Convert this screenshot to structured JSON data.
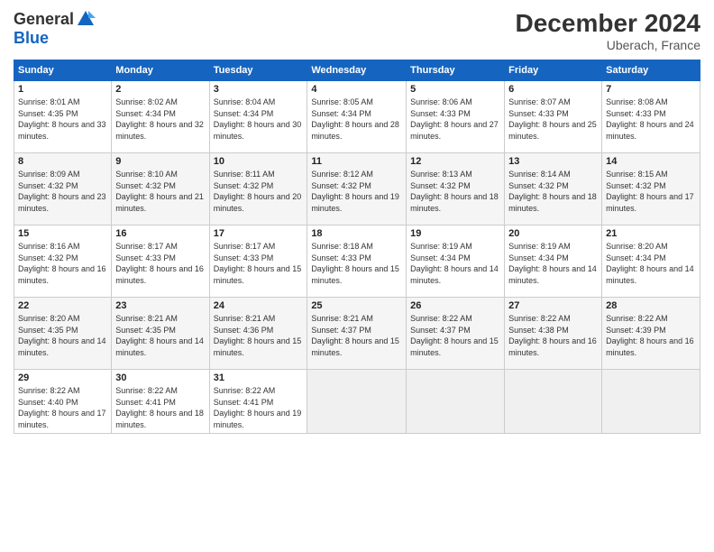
{
  "header": {
    "logo_general": "General",
    "logo_blue": "Blue",
    "month_title": "December 2024",
    "location": "Uberach, France"
  },
  "days_of_week": [
    "Sunday",
    "Monday",
    "Tuesday",
    "Wednesday",
    "Thursday",
    "Friday",
    "Saturday"
  ],
  "weeks": [
    [
      {
        "day": "1",
        "sunrise": "8:01 AM",
        "sunset": "4:35 PM",
        "daylight": "8 hours and 33 minutes."
      },
      {
        "day": "2",
        "sunrise": "8:02 AM",
        "sunset": "4:34 PM",
        "daylight": "8 hours and 32 minutes."
      },
      {
        "day": "3",
        "sunrise": "8:04 AM",
        "sunset": "4:34 PM",
        "daylight": "8 hours and 30 minutes."
      },
      {
        "day": "4",
        "sunrise": "8:05 AM",
        "sunset": "4:34 PM",
        "daylight": "8 hours and 28 minutes."
      },
      {
        "day": "5",
        "sunrise": "8:06 AM",
        "sunset": "4:33 PM",
        "daylight": "8 hours and 27 minutes."
      },
      {
        "day": "6",
        "sunrise": "8:07 AM",
        "sunset": "4:33 PM",
        "daylight": "8 hours and 25 minutes."
      },
      {
        "day": "7",
        "sunrise": "8:08 AM",
        "sunset": "4:33 PM",
        "daylight": "8 hours and 24 minutes."
      }
    ],
    [
      {
        "day": "8",
        "sunrise": "8:09 AM",
        "sunset": "4:32 PM",
        "daylight": "8 hours and 23 minutes."
      },
      {
        "day": "9",
        "sunrise": "8:10 AM",
        "sunset": "4:32 PM",
        "daylight": "8 hours and 21 minutes."
      },
      {
        "day": "10",
        "sunrise": "8:11 AM",
        "sunset": "4:32 PM",
        "daylight": "8 hours and 20 minutes."
      },
      {
        "day": "11",
        "sunrise": "8:12 AM",
        "sunset": "4:32 PM",
        "daylight": "8 hours and 19 minutes."
      },
      {
        "day": "12",
        "sunrise": "8:13 AM",
        "sunset": "4:32 PM",
        "daylight": "8 hours and 18 minutes."
      },
      {
        "day": "13",
        "sunrise": "8:14 AM",
        "sunset": "4:32 PM",
        "daylight": "8 hours and 18 minutes."
      },
      {
        "day": "14",
        "sunrise": "8:15 AM",
        "sunset": "4:32 PM",
        "daylight": "8 hours and 17 minutes."
      }
    ],
    [
      {
        "day": "15",
        "sunrise": "8:16 AM",
        "sunset": "4:32 PM",
        "daylight": "8 hours and 16 minutes."
      },
      {
        "day": "16",
        "sunrise": "8:17 AM",
        "sunset": "4:33 PM",
        "daylight": "8 hours and 16 minutes."
      },
      {
        "day": "17",
        "sunrise": "8:17 AM",
        "sunset": "4:33 PM",
        "daylight": "8 hours and 15 minutes."
      },
      {
        "day": "18",
        "sunrise": "8:18 AM",
        "sunset": "4:33 PM",
        "daylight": "8 hours and 15 minutes."
      },
      {
        "day": "19",
        "sunrise": "8:19 AM",
        "sunset": "4:34 PM",
        "daylight": "8 hours and 14 minutes."
      },
      {
        "day": "20",
        "sunrise": "8:19 AM",
        "sunset": "4:34 PM",
        "daylight": "8 hours and 14 minutes."
      },
      {
        "day": "21",
        "sunrise": "8:20 AM",
        "sunset": "4:34 PM",
        "daylight": "8 hours and 14 minutes."
      }
    ],
    [
      {
        "day": "22",
        "sunrise": "8:20 AM",
        "sunset": "4:35 PM",
        "daylight": "8 hours and 14 minutes."
      },
      {
        "day": "23",
        "sunrise": "8:21 AM",
        "sunset": "4:35 PM",
        "daylight": "8 hours and 14 minutes."
      },
      {
        "day": "24",
        "sunrise": "8:21 AM",
        "sunset": "4:36 PM",
        "daylight": "8 hours and 15 minutes."
      },
      {
        "day": "25",
        "sunrise": "8:21 AM",
        "sunset": "4:37 PM",
        "daylight": "8 hours and 15 minutes."
      },
      {
        "day": "26",
        "sunrise": "8:22 AM",
        "sunset": "4:37 PM",
        "daylight": "8 hours and 15 minutes."
      },
      {
        "day": "27",
        "sunrise": "8:22 AM",
        "sunset": "4:38 PM",
        "daylight": "8 hours and 16 minutes."
      },
      {
        "day": "28",
        "sunrise": "8:22 AM",
        "sunset": "4:39 PM",
        "daylight": "8 hours and 16 minutes."
      }
    ],
    [
      {
        "day": "29",
        "sunrise": "8:22 AM",
        "sunset": "4:40 PM",
        "daylight": "8 hours and 17 minutes."
      },
      {
        "day": "30",
        "sunrise": "8:22 AM",
        "sunset": "4:41 PM",
        "daylight": "8 hours and 18 minutes."
      },
      {
        "day": "31",
        "sunrise": "8:22 AM",
        "sunset": "4:41 PM",
        "daylight": "8 hours and 19 minutes."
      },
      null,
      null,
      null,
      null
    ]
  ]
}
